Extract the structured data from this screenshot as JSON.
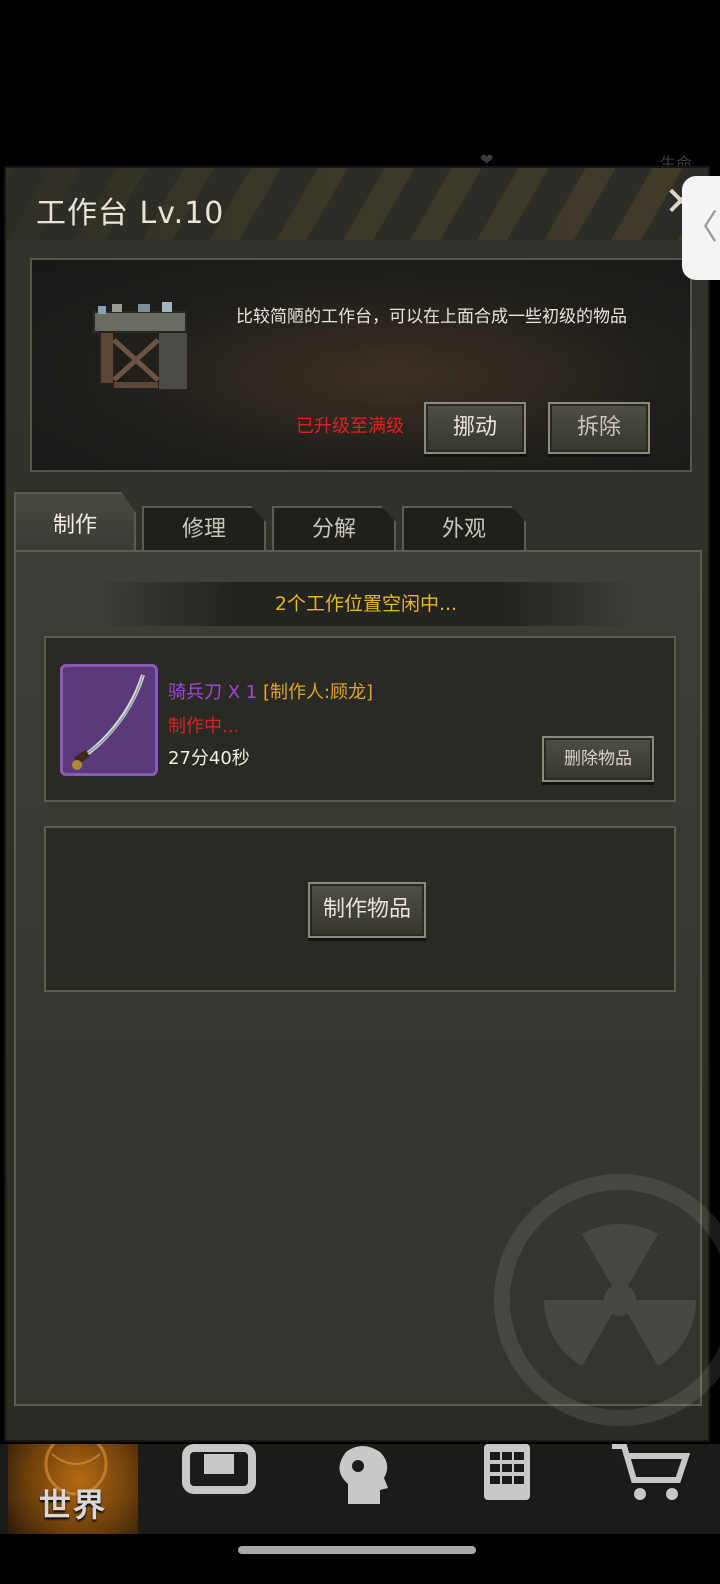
{
  "background": {
    "status_right": "生命"
  },
  "panel": {
    "title": "工作台 Lv.10",
    "close_glyph": "✕",
    "side_handle_glyph": "〈"
  },
  "info": {
    "description": "比较简陋的工作台，可以在上面合成一些初级的物品",
    "max_level_label": "已升级至满级",
    "move_label": "挪动",
    "dismantle_label": "拆除",
    "bench_icon": "workbench-icon"
  },
  "tabs": [
    {
      "label": "制作",
      "active": true
    },
    {
      "label": "修理",
      "active": false
    },
    {
      "label": "分解",
      "active": false
    },
    {
      "label": "外观",
      "active": false
    }
  ],
  "craft": {
    "status_text": "2个工作位置空闲中...",
    "slot1": {
      "item_name": "骑兵刀 X 1",
      "crafter": " [制作人:顾龙]",
      "status": "制作中...",
      "time_left": "27分40秒",
      "delete_label": "删除物品",
      "icon": "saber-icon"
    },
    "slot2": {
      "craft_label": "制作物品"
    }
  },
  "bottom_nav": [
    {
      "label": "世界",
      "icon": "globe-icon"
    },
    {
      "label": "",
      "icon": "backpack-icon"
    },
    {
      "label": "",
      "icon": "head-icon"
    },
    {
      "label": "",
      "icon": "calculator-icon"
    },
    {
      "label": "",
      "icon": "cart-icon"
    }
  ],
  "colors": {
    "accent_yellow": "#e6b822",
    "alert_red": "#e02020",
    "rare_purple": "#a346d6",
    "crafter_orange": "#e0a528"
  }
}
